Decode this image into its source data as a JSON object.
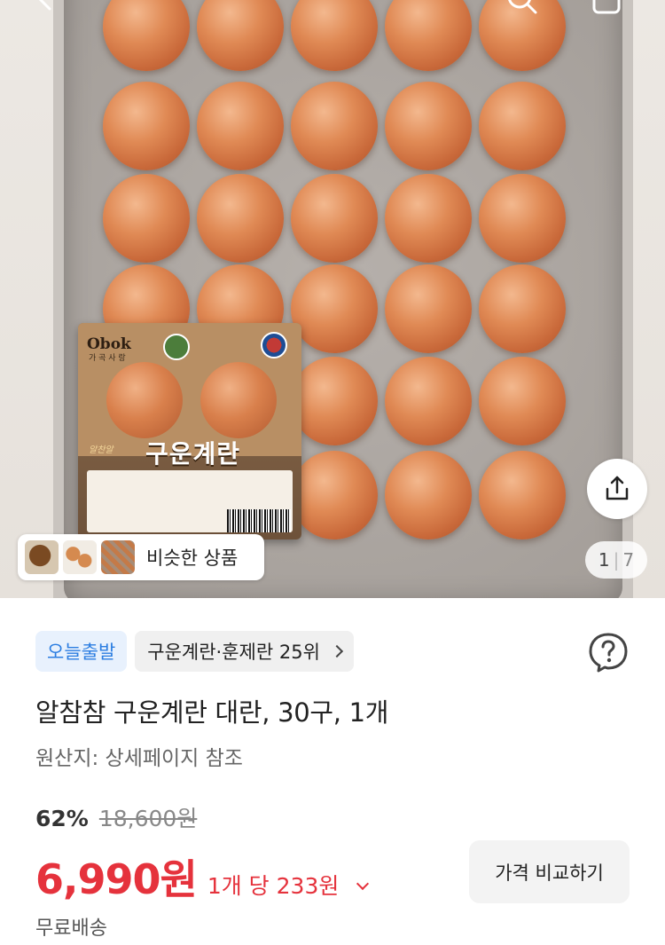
{
  "gallery": {
    "current_page": "1",
    "separator": "|",
    "total_pages": "7",
    "similar_label": "비슷한 상품",
    "package": {
      "brand": "Obok",
      "brand_sub": "가 곡 사 랑",
      "title": "구운계란",
      "mark": "알찬알"
    }
  },
  "badges": {
    "today_shipping": "오늘출발",
    "category_rank": "구운계란·훈제란 25위"
  },
  "product": {
    "title": "알참참 구운계란 대란, 30구, 1개",
    "origin": "원산지: 상세페이지 참조",
    "discount_rate": "62%",
    "original_price": "18,600원",
    "price": "6,990원",
    "unit_price": "1개 당 233원",
    "compare_button": "가격 비교하기",
    "shipping": "무료배송"
  },
  "colors": {
    "accent_red": "#e5323c",
    "badge_blue": "#2b7de1",
    "badge_blue_bg": "#e8f1fd"
  },
  "icons": [
    "back-icon",
    "search-icon",
    "cart-icon",
    "share-icon",
    "help-icon",
    "chevron-right-icon",
    "chevron-down-icon"
  ]
}
